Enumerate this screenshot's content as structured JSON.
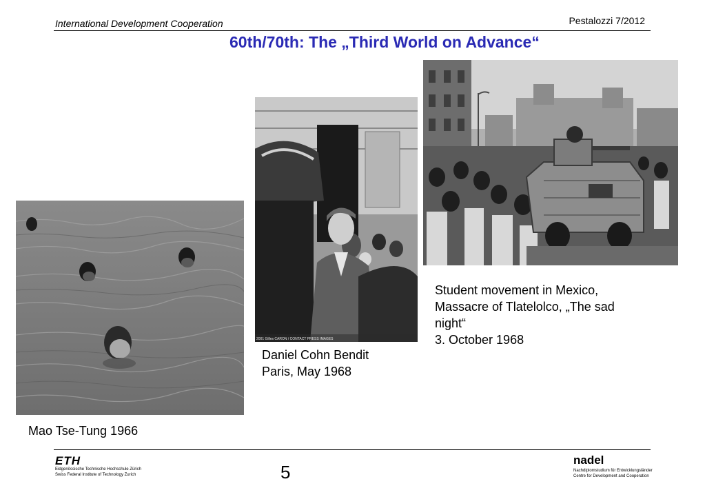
{
  "header": {
    "left_text": "International Development Cooperation",
    "right_text": "Pestalozzi 7/2012"
  },
  "slide": {
    "title": "60th/70th: The „Third World on Advance“",
    "page_number": "5"
  },
  "photos": [
    {
      "caption_lines": [
        "Mao Tse-Tung 1966"
      ]
    },
    {
      "caption_lines": [
        "Daniel Cohn Bendit",
        "Paris, May 1968"
      ],
      "credit": "2001 Gilles CARON / CONTACT PRESS IMAGES"
    },
    {
      "caption_lines": [
        "Student movement in Mexico,",
        "Massacre of Tlatelolco, „The sad",
        "night“",
        "3. October 1968"
      ]
    }
  ],
  "footer": {
    "eth_logo": "ETH",
    "eth_line1": "Eidgenössische Technische Hochschule Zürich",
    "eth_line2": "Swiss Federal Institute of Technology Zurich",
    "nadel_logo": "nadel",
    "nadel_line1": "Nachdiplomstudium für Entwicklungsländer",
    "nadel_line2": "Centre for Development and Cooperation"
  }
}
